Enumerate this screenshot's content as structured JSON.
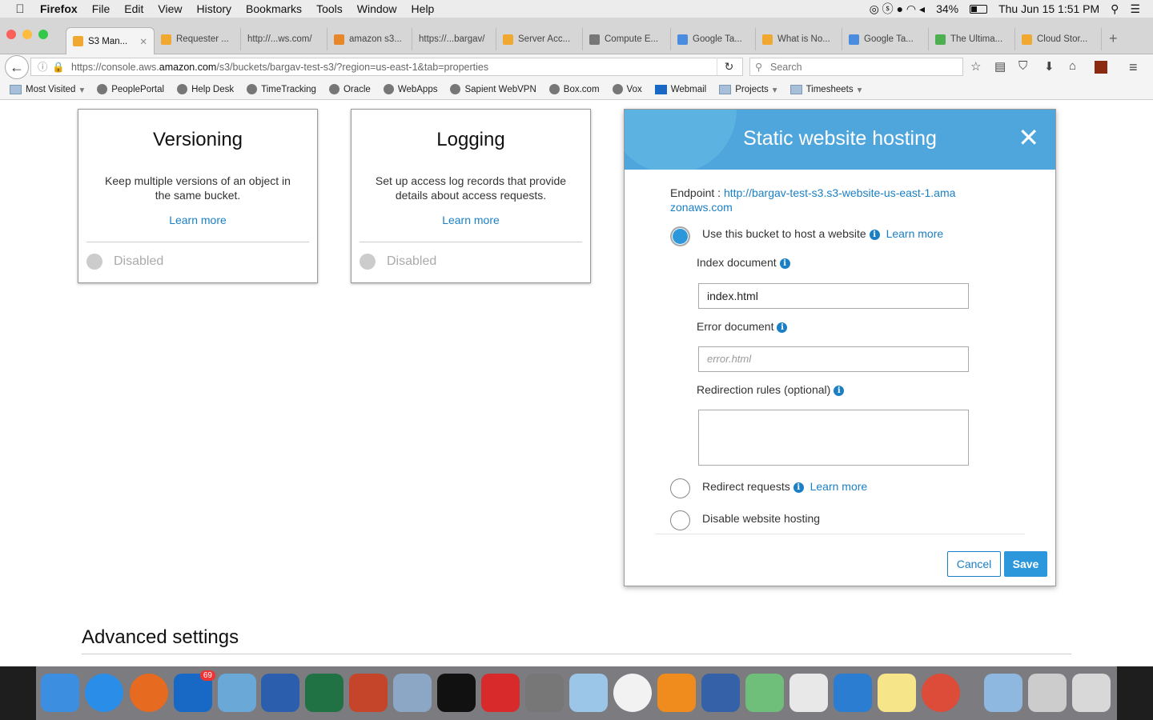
{
  "menubar": {
    "app": "Firefox",
    "items": [
      "File",
      "Edit",
      "View",
      "History",
      "Bookmarks",
      "Tools",
      "Window",
      "Help"
    ],
    "battery": "34%",
    "datetime": "Thu Jun 15  1:51 PM"
  },
  "tabs": [
    {
      "label": "S3 Man...",
      "color": "#f0a830",
      "active": true
    },
    {
      "label": "Requester ...",
      "color": "#f0a830"
    },
    {
      "label": "http://...ws.com/",
      "color": ""
    },
    {
      "label": "amazon s3...",
      "color": "#e8862a"
    },
    {
      "label": "https://...bargav/",
      "color": ""
    },
    {
      "label": "Server Acc...",
      "color": "#f0a830"
    },
    {
      "label": "Compute E...",
      "color": "#777"
    },
    {
      "label": "Google Ta...",
      "color": "#4a8de0"
    },
    {
      "label": "What is No...",
      "color": "#f0a830"
    },
    {
      "label": "Google Ta...",
      "color": "#4a8de0"
    },
    {
      "label": "The Ultima...",
      "color": "#4cb050"
    },
    {
      "label": "Cloud Stor...",
      "color": "#f0a830"
    }
  ],
  "nav": {
    "url_prefix": "https://console.aws.",
    "url_domain": "amazon.com",
    "url_suffix": "/s3/buckets/bargav-test-s3/?region=us-east-1&tab=properties",
    "search_placeholder": "Search"
  },
  "bookmarks": [
    {
      "label": "Most Visited",
      "type": "folder",
      "dropdown": true
    },
    {
      "label": "PeoplePortal",
      "type": "site"
    },
    {
      "label": "Help Desk",
      "type": "site"
    },
    {
      "label": "TimeTracking",
      "type": "site"
    },
    {
      "label": "Oracle",
      "type": "site"
    },
    {
      "label": "WebApps",
      "type": "site"
    },
    {
      "label": "Sapient WebVPN",
      "type": "site"
    },
    {
      "label": "Box.com",
      "type": "site"
    },
    {
      "label": "Vox",
      "type": "site"
    },
    {
      "label": "Webmail",
      "type": "outlook"
    },
    {
      "label": "Projects",
      "type": "folder",
      "dropdown": true
    },
    {
      "label": "Timesheets",
      "type": "folder",
      "dropdown": true
    }
  ],
  "cards": [
    {
      "title": "Versioning",
      "desc": "Keep multiple versions of an object in the same bucket.",
      "link": "Learn more",
      "status": "Disabled"
    },
    {
      "title": "Logging",
      "desc": "Set up access log records that provide details about access requests.",
      "link": "Learn more",
      "status": "Disabled"
    }
  ],
  "modal": {
    "title": "Static website hosting",
    "endpoint_label": "Endpoint : ",
    "endpoint_url": "http://bargav-test-s3.s3-website-us-east-1.amazonaws.com",
    "option_host": "Use this bucket to host a website",
    "learn_more": "Learn more",
    "index_label": "Index document",
    "index_value": "index.html",
    "error_label": "Error document",
    "error_placeholder": "error.html",
    "redirect_label": "Redirection rules (optional)",
    "option_redirect": "Redirect requests",
    "option_disable": "Disable website hosting",
    "selected": "host",
    "cancel": "Cancel",
    "save": "Save",
    "accent": "#2d97db"
  },
  "advanced_settings": "Advanced settings",
  "dock": [
    {
      "name": "finder",
      "color": "#3c8fe0"
    },
    {
      "name": "safari",
      "color": "#2a8ee8"
    },
    {
      "name": "firefox",
      "color": "#e66a1f"
    },
    {
      "name": "outlook",
      "color": "#1769c5",
      "badge": "69"
    },
    {
      "name": "lync",
      "color": "#6aa8d8"
    },
    {
      "name": "word",
      "color": "#2b5fad"
    },
    {
      "name": "excel",
      "color": "#207245"
    },
    {
      "name": "powerpoint",
      "color": "#c5452a"
    },
    {
      "name": "preview",
      "color": "#8ba7c5"
    },
    {
      "name": "terminal",
      "color": "#111111"
    },
    {
      "name": "git-client",
      "color": "#d82a2a"
    },
    {
      "name": "system-preferences",
      "color": "#777777"
    },
    {
      "name": "maps",
      "color": "#9cc6e8"
    },
    {
      "name": "photos",
      "color": "#f2f2f2"
    },
    {
      "name": "ibooks",
      "color": "#f08b1d"
    },
    {
      "name": "virtualbox",
      "color": "#3461a8"
    },
    {
      "name": "atom",
      "color": "#6fbf7a"
    },
    {
      "name": "slack",
      "color": "#e8e8e8"
    },
    {
      "name": "vscode",
      "color": "#2b7dd2"
    },
    {
      "name": "notes",
      "color": "#f7e58a"
    },
    {
      "name": "chrome",
      "color": "#dd4b39"
    },
    {
      "name": "applications-folder",
      "color": "#8fb8e0"
    },
    {
      "name": "documents",
      "color": "#cccccc"
    },
    {
      "name": "trash",
      "color": "#d8d8d8"
    }
  ]
}
